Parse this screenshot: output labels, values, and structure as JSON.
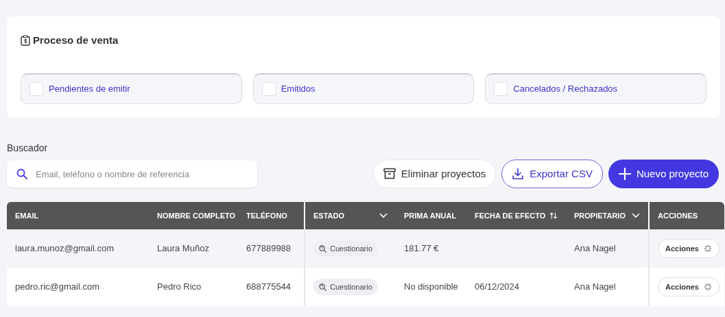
{
  "sales_process": {
    "title": "Proceso de venta",
    "filters": [
      {
        "label": "Pendientes de emitir",
        "checked": false
      },
      {
        "label": "Emitidos",
        "checked": false
      },
      {
        "label": "Cancelados / Rechazados",
        "checked": false
      }
    ]
  },
  "search": {
    "label": "Buscador",
    "placeholder": "Email, teléfono o nombre de referencia"
  },
  "buttons": [
    {
      "label": "Eliminar proyectos",
      "kind": "delete"
    },
    {
      "label": "Exportar CSV",
      "kind": "export"
    },
    {
      "label": "Nuevo proyecto",
      "kind": "new"
    }
  ],
  "table": {
    "columns": [
      {
        "label": "EMAIL"
      },
      {
        "label": "NOMBRE COMPLETO"
      },
      {
        "label": "TELÉFONO"
      },
      {
        "label": "ESTADO",
        "dropdown": true
      },
      {
        "label": "PRIMA ANUAL"
      },
      {
        "label": "FECHA DE EFECTO",
        "sortable": true
      },
      {
        "label": "PROPIETARIO",
        "dropdown": true
      },
      {
        "label": "ACCIONES"
      }
    ],
    "rows": [
      {
        "email": "laura.munoz@gmail.com",
        "name": "Laura Muñoz",
        "phone": "677889988",
        "status": "Cuestionario",
        "premium": "181.77 €",
        "owner": "Ana Nagel",
        "action": "Acciones"
      },
      {
        "email": "pedro.ric@gmail.com",
        "name": "Pedro Rico",
        "phone": "688775544",
        "status": "Cuestionario",
        "premium": "No disponible",
        "date": "06/12/2024",
        "owner": "Ana Nagel",
        "action": "Acciones"
      }
    ]
  }
}
